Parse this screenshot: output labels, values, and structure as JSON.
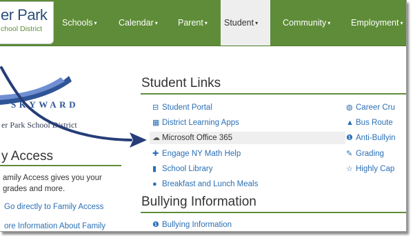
{
  "logo": {
    "line1": "er Park",
    "line2": "chool District"
  },
  "nav": [
    {
      "label": "Schools",
      "caret": "▾"
    },
    {
      "label": "Calendar",
      "caret": "▾"
    },
    {
      "label": "Parent",
      "caret": "▾"
    },
    {
      "label": "Student",
      "caret": "▾"
    },
    {
      "label": "Community",
      "caret": "▾"
    },
    {
      "label": "Employment",
      "caret": "▾"
    }
  ],
  "skyward": {
    "wordmark": "SKYWARD",
    "district": "er Park School District"
  },
  "family_access": {
    "heading": "y Access",
    "description": "amily Access gives you your grades and more.",
    "link": "Go directly to Family Access",
    "more": "ore Information About Family Access"
  },
  "student_links": {
    "title": "Student Links",
    "left": [
      {
        "label": "Student Portal",
        "icon": "portal-icon"
      },
      {
        "label": "District Learning Apps",
        "icon": "apps-icon"
      },
      {
        "label": "Microsoft Office 365",
        "icon": "cloud-icon"
      },
      {
        "label": "Engage NY Math Help",
        "icon": "plus-icon"
      },
      {
        "label": "School Library",
        "icon": "book-icon"
      },
      {
        "label": "Breakfast and Lunch Meals",
        "icon": "apple-icon"
      }
    ],
    "right": [
      {
        "label": "Career Cru",
        "icon": "globe-icon"
      },
      {
        "label": "Bus Route",
        "icon": "road-icon"
      },
      {
        "label": "Anti-Bullyin",
        "icon": "exclamation-icon"
      },
      {
        "label": "Grading",
        "icon": "pencil-icon"
      },
      {
        "label": "Highly Cap",
        "icon": "star-icon"
      }
    ]
  },
  "bullying": {
    "title": "Bullying Information",
    "links": [
      {
        "label": "Bullying Information",
        "icon": "exclamation-icon"
      }
    ]
  },
  "colors": {
    "nav_green": "#5e8c38",
    "link_blue": "#2a6fb5",
    "arrow_navy": "#263d78"
  }
}
